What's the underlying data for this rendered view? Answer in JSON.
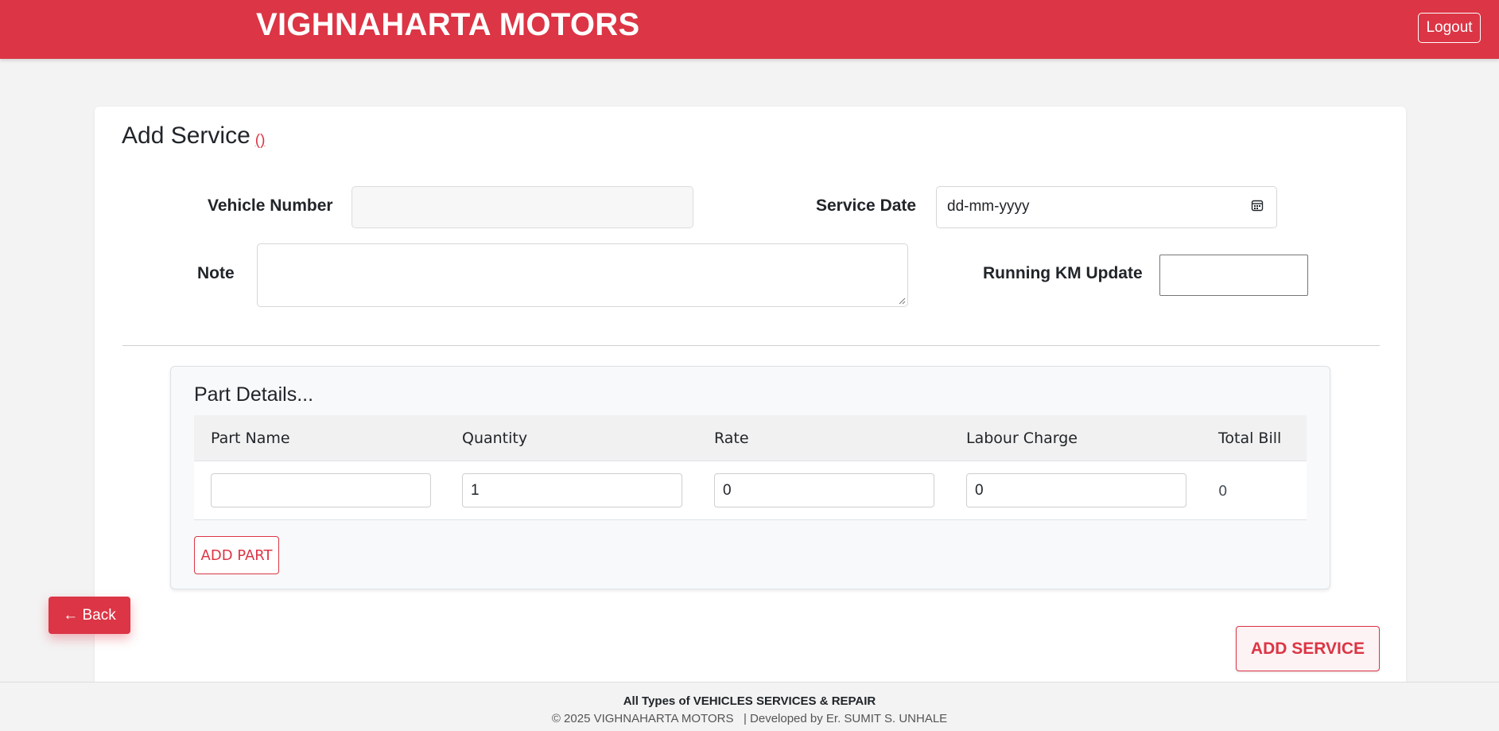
{
  "header": {
    "brand": "VIGHNAHARTA MOTORS",
    "logout_label": "Logout"
  },
  "form": {
    "title": "Add Service",
    "title_suffix": "()",
    "vehicle_number_label": "Vehicle Number",
    "vehicle_number_value": "",
    "service_date_label": "Service Date",
    "service_date_placeholder": "dd-mm-yyyy",
    "note_label": "Note",
    "note_value": "",
    "running_km_label": "Running KM Update",
    "running_km_value": ""
  },
  "parts": {
    "title": "Part Details...",
    "columns": [
      "Part Name",
      "Quantity",
      "Rate",
      "Labour Charge",
      "Total Bill"
    ],
    "rows": [
      {
        "part_name": "",
        "quantity": "1",
        "rate": "0",
        "labour_charge": "0",
        "total_bill": "0"
      }
    ],
    "add_part_label": "ADD PART"
  },
  "actions": {
    "back_label": "← Back",
    "add_service_label": "ADD SERVICE"
  },
  "footer": {
    "line1": "All Types of VEHICLES SERVICES & REPAIR",
    "line2": "© 2025 VIGHNAHARTA MOTORS   | Developed by Er. SUMIT S. UNHALE"
  },
  "colors": {
    "brand": "#dc3545",
    "background": "#f3f3f3",
    "card": "#ffffff"
  }
}
